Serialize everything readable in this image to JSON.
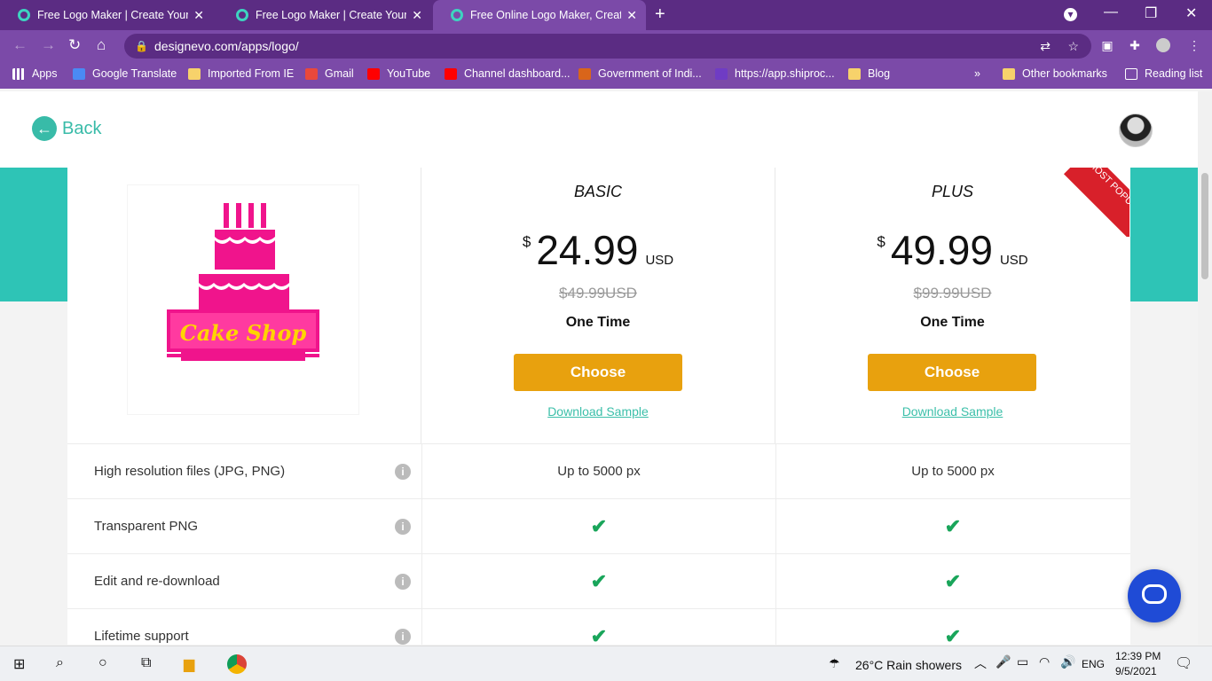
{
  "browser": {
    "tabs": [
      {
        "title": "Free Logo Maker | Create Your Lo"
      },
      {
        "title": "Free Logo Maker | Create Your Lo"
      },
      {
        "title": "Free Online Logo Maker, Create L"
      }
    ],
    "url": "designevo.com/apps/logo/",
    "bookmarks": [
      {
        "label": "Apps"
      },
      {
        "label": "Google Translate"
      },
      {
        "label": "Imported From IE"
      },
      {
        "label": "Gmail"
      },
      {
        "label": "YouTube"
      },
      {
        "label": "Channel dashboard..."
      },
      {
        "label": "Government of Indi..."
      },
      {
        "label": "https://app.shiproc..."
      },
      {
        "label": "Blog"
      }
    ],
    "more_bookmarks": "»",
    "other_bookmarks": "Other bookmarks",
    "reading_list": "Reading list"
  },
  "page": {
    "back_label": "Back",
    "logo_text": "Cake Shop",
    "plans": [
      {
        "name": "BASIC",
        "currency": "$",
        "amount": "24.99",
        "unit": "USD",
        "original": "$49.99USD",
        "term": "One Time",
        "button": "Choose",
        "sample": "Download Sample",
        "ribbon": ""
      },
      {
        "name": "PLUS",
        "currency": "$",
        "amount": "49.99",
        "unit": "USD",
        "original": "$99.99USD",
        "term": "One Time",
        "button": "Choose",
        "sample": "Download Sample",
        "ribbon": "MOST POPULAR"
      }
    ],
    "features": [
      {
        "name": "High resolution files (JPG, PNG)",
        "basic": "Up to 5000 px",
        "plus": "Up to 5000 px"
      },
      {
        "name": "Transparent PNG",
        "basic": "✔",
        "plus": "✔"
      },
      {
        "name": "Edit and re-download",
        "basic": "✔",
        "plus": "✔"
      },
      {
        "name": "Lifetime support",
        "basic": "✔",
        "plus": "✔"
      }
    ],
    "info_icon": "i"
  },
  "taskbar": {
    "weather": "26°C  Rain showers",
    "language": "ENG",
    "time": "12:39 PM",
    "date": "9/5/2021"
  },
  "colors": {
    "accent": "#38bba8",
    "choose_button": "#e8a10e",
    "browser_frame": "#7b4aa8",
    "ribbon": "#d8202a",
    "check": "#19a55a"
  }
}
